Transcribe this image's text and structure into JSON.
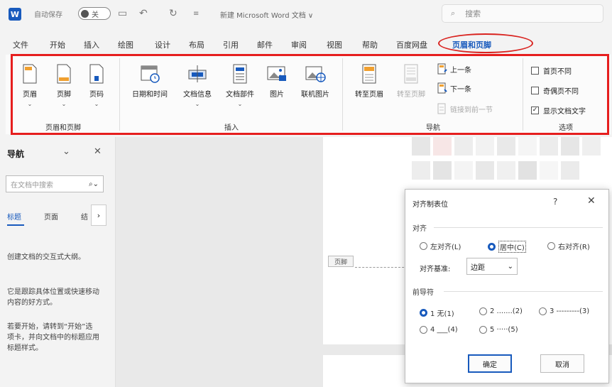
{
  "titlebar": {
    "logo": "W",
    "autosave_label": "自动保存",
    "autosave_state": "关",
    "doc_title": "新建 Microsoft Word 文档 ∨",
    "search_placeholder": "搜索"
  },
  "tabs": [
    "文件",
    "开始",
    "插入",
    "绘图",
    "设计",
    "布局",
    "引用",
    "邮件",
    "审阅",
    "视图",
    "帮助",
    "百度网盘",
    "页眉和页脚"
  ],
  "active_tab": "页眉和页脚",
  "ribbon": {
    "group1": {
      "buttons": [
        "页眉",
        "页脚",
        "页码"
      ],
      "label": "页眉和页脚"
    },
    "group2": {
      "buttons": [
        "日期和时间",
        "文档信息",
        "文档部件",
        "图片",
        "联机图片"
      ],
      "label": "插入"
    },
    "group3": {
      "goto_header": "转至页眉",
      "goto_footer": "转至页脚",
      "prev": "上一条",
      "next": "下一条",
      "link_prev": "链接到前一节",
      "label": "导航"
    },
    "group4": {
      "options": [
        {
          "label": "首页不同",
          "checked": false
        },
        {
          "label": "奇偶页不同",
          "checked": false
        },
        {
          "label": "显示文档文字",
          "checked": true
        }
      ],
      "label": "选项"
    }
  },
  "navpane": {
    "title": "导航",
    "search_placeholder": "在文档中搜索",
    "tabs": [
      "标题",
      "页面",
      "结"
    ],
    "para1": "创建文档的交互式大纲。",
    "para2": "它是跟踪具体位置或快速移动内容的好方式。",
    "para3": "若要开始，请转到“开始”选项卡，并向文档中的标题应用标题样式。"
  },
  "document": {
    "header_tag": "页脚"
  },
  "dialog": {
    "title": "对齐制表位",
    "help": "?",
    "close": "✕",
    "align_section": "对齐",
    "align_options": [
      {
        "label": "左对齐(L)",
        "selected": false
      },
      {
        "label": "居中(C)",
        "selected": true
      },
      {
        "label": "右对齐(R)",
        "selected": false
      }
    ],
    "align_base_label": "对齐基准:",
    "align_base_value": "边距",
    "leader_section": "前导符",
    "leader_options": [
      {
        "label": "1 无(1)",
        "selected": true
      },
      {
        "label": "2 .......(2)",
        "selected": false
      },
      {
        "label": "3 ---------(3)",
        "selected": false
      },
      {
        "label": "4 ___(4)",
        "selected": false
      },
      {
        "label": "5 ·····(5)",
        "selected": false
      }
    ],
    "ok": "确定",
    "cancel": "取消"
  },
  "colors": {
    "accent": "#185abd",
    "highlight": "#e61e1e"
  }
}
